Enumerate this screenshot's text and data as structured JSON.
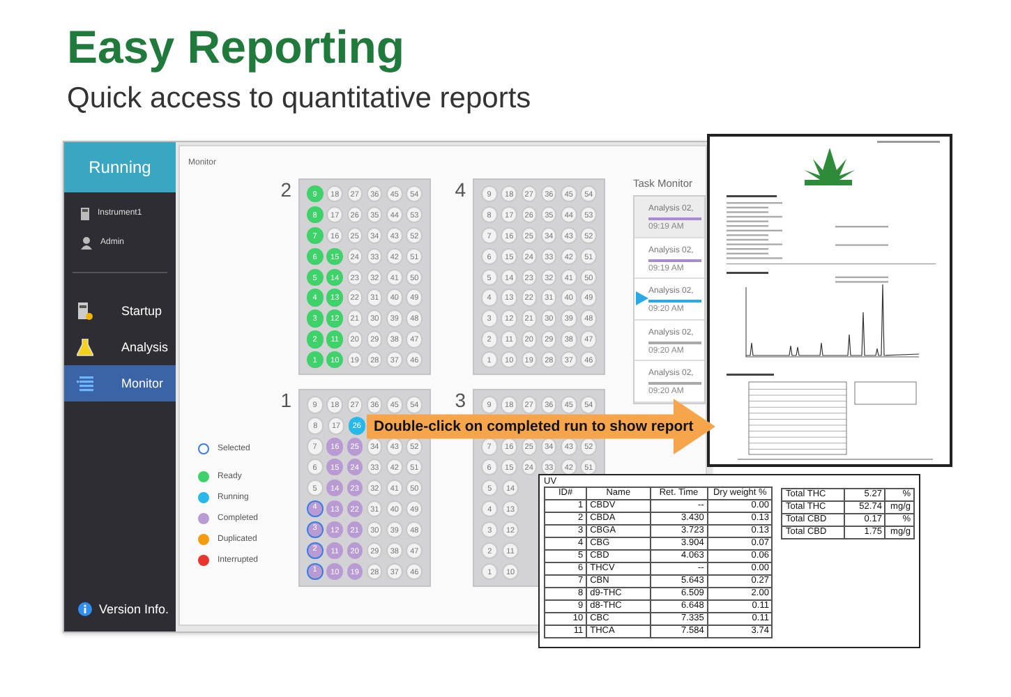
{
  "header": {
    "title": "Easy Reporting",
    "subtitle": "Quick access to quantitative reports"
  },
  "sidebar": {
    "status": "Running",
    "instrument": "Instrument1",
    "user": "Admin",
    "nav": [
      {
        "label": "Startup",
        "selected": false
      },
      {
        "label": "Analysis",
        "selected": false
      },
      {
        "label": "Monitor",
        "selected": true
      }
    ],
    "version": "Version Info."
  },
  "page_title": "Monitor",
  "legend": [
    {
      "label": "Selected",
      "kind": "ring",
      "color": "#3b7de0"
    },
    {
      "label": "Ready",
      "kind": "dot",
      "color": "#3fd16a"
    },
    {
      "label": "Running",
      "kind": "dot",
      "color": "#29b9e8"
    },
    {
      "label": "Completed",
      "kind": "dot",
      "color": "#b99bd3"
    },
    {
      "label": "Duplicated",
      "kind": "dot",
      "color": "#f39c12"
    },
    {
      "label": "Interrupted",
      "kind": "dot",
      "color": "#e8352e"
    }
  ],
  "plates": [
    {
      "label": "2",
      "rows": [
        [
          {
            "number": "9",
            "kind": "ready",
            "selected": false
          },
          {
            "number": "18",
            "kind": "empty",
            "selected": false
          },
          {
            "number": "27",
            "kind": "empty",
            "selected": false
          },
          {
            "number": "36",
            "kind": "empty",
            "selected": false
          },
          {
            "number": "45",
            "kind": "empty",
            "selected": false
          },
          {
            "number": "54",
            "kind": "empty",
            "selected": false
          }
        ],
        [
          {
            "number": "8",
            "kind": "ready",
            "selected": false
          },
          {
            "number": "17",
            "kind": "empty",
            "selected": false
          },
          {
            "number": "26",
            "kind": "empty",
            "selected": false
          },
          {
            "number": "35",
            "kind": "empty",
            "selected": false
          },
          {
            "number": "44",
            "kind": "empty",
            "selected": false
          },
          {
            "number": "53",
            "kind": "empty",
            "selected": false
          }
        ],
        [
          {
            "number": "7",
            "kind": "ready",
            "selected": false
          },
          {
            "number": "16",
            "kind": "empty",
            "selected": false
          },
          {
            "number": "25",
            "kind": "empty",
            "selected": false
          },
          {
            "number": "34",
            "kind": "empty",
            "selected": false
          },
          {
            "number": "43",
            "kind": "empty",
            "selected": false
          },
          {
            "number": "52",
            "kind": "empty",
            "selected": false
          }
        ],
        [
          {
            "number": "6",
            "kind": "ready",
            "selected": false
          },
          {
            "number": "15",
            "kind": "ready",
            "selected": false
          },
          {
            "number": "24",
            "kind": "empty",
            "selected": false
          },
          {
            "number": "33",
            "kind": "empty",
            "selected": false
          },
          {
            "number": "42",
            "kind": "empty",
            "selected": false
          },
          {
            "number": "51",
            "kind": "empty",
            "selected": false
          }
        ],
        [
          {
            "number": "5",
            "kind": "ready",
            "selected": false
          },
          {
            "number": "14",
            "kind": "ready",
            "selected": false
          },
          {
            "number": "23",
            "kind": "empty",
            "selected": false
          },
          {
            "number": "32",
            "kind": "empty",
            "selected": false
          },
          {
            "number": "41",
            "kind": "empty",
            "selected": false
          },
          {
            "number": "50",
            "kind": "empty",
            "selected": false
          }
        ],
        [
          {
            "number": "4",
            "kind": "ready",
            "selected": false
          },
          {
            "number": "13",
            "kind": "ready",
            "selected": false
          },
          {
            "number": "22",
            "kind": "empty",
            "selected": false
          },
          {
            "number": "31",
            "kind": "empty",
            "selected": false
          },
          {
            "number": "40",
            "kind": "empty",
            "selected": false
          },
          {
            "number": "49",
            "kind": "empty",
            "selected": false
          }
        ],
        [
          {
            "number": "3",
            "kind": "ready",
            "selected": false
          },
          {
            "number": "12",
            "kind": "ready",
            "selected": false
          },
          {
            "number": "21",
            "kind": "empty",
            "selected": false
          },
          {
            "number": "30",
            "kind": "empty",
            "selected": false
          },
          {
            "number": "39",
            "kind": "empty",
            "selected": false
          },
          {
            "number": "48",
            "kind": "empty",
            "selected": false
          }
        ],
        [
          {
            "number": "2",
            "kind": "ready",
            "selected": false
          },
          {
            "number": "11",
            "kind": "ready",
            "selected": false
          },
          {
            "number": "20",
            "kind": "empty",
            "selected": false
          },
          {
            "number": "29",
            "kind": "empty",
            "selected": false
          },
          {
            "number": "38",
            "kind": "empty",
            "selected": false
          },
          {
            "number": "47",
            "kind": "empty",
            "selected": false
          }
        ],
        [
          {
            "number": "1",
            "kind": "ready",
            "selected": false
          },
          {
            "number": "10",
            "kind": "ready",
            "selected": false
          },
          {
            "number": "19",
            "kind": "empty",
            "selected": false
          },
          {
            "number": "28",
            "kind": "empty",
            "selected": false
          },
          {
            "number": "37",
            "kind": "empty",
            "selected": false
          },
          {
            "number": "46",
            "kind": "empty",
            "selected": false
          }
        ]
      ]
    },
    {
      "label": "4",
      "rows": [
        [
          {
            "number": "9",
            "kind": "empty",
            "selected": false
          },
          {
            "number": "18",
            "kind": "empty",
            "selected": false
          },
          {
            "number": "27",
            "kind": "empty",
            "selected": false
          },
          {
            "number": "36",
            "kind": "empty",
            "selected": false
          },
          {
            "number": "45",
            "kind": "empty",
            "selected": false
          },
          {
            "number": "54",
            "kind": "empty",
            "selected": false
          }
        ],
        [
          {
            "number": "8",
            "kind": "empty",
            "selected": false
          },
          {
            "number": "17",
            "kind": "empty",
            "selected": false
          },
          {
            "number": "26",
            "kind": "empty",
            "selected": false
          },
          {
            "number": "35",
            "kind": "empty",
            "selected": false
          },
          {
            "number": "44",
            "kind": "empty",
            "selected": false
          },
          {
            "number": "53",
            "kind": "empty",
            "selected": false
          }
        ],
        [
          {
            "number": "7",
            "kind": "empty",
            "selected": false
          },
          {
            "number": "16",
            "kind": "empty",
            "selected": false
          },
          {
            "number": "25",
            "kind": "empty",
            "selected": false
          },
          {
            "number": "34",
            "kind": "empty",
            "selected": false
          },
          {
            "number": "43",
            "kind": "empty",
            "selected": false
          },
          {
            "number": "52",
            "kind": "empty",
            "selected": false
          }
        ],
        [
          {
            "number": "6",
            "kind": "empty",
            "selected": false
          },
          {
            "number": "15",
            "kind": "empty",
            "selected": false
          },
          {
            "number": "24",
            "kind": "empty",
            "selected": false
          },
          {
            "number": "33",
            "kind": "empty",
            "selected": false
          },
          {
            "number": "42",
            "kind": "empty",
            "selected": false
          },
          {
            "number": "51",
            "kind": "empty",
            "selected": false
          }
        ],
        [
          {
            "number": "5",
            "kind": "empty",
            "selected": false
          },
          {
            "number": "14",
            "kind": "empty",
            "selected": false
          },
          {
            "number": "23",
            "kind": "empty",
            "selected": false
          },
          {
            "number": "32",
            "kind": "empty",
            "selected": false
          },
          {
            "number": "41",
            "kind": "empty",
            "selected": false
          },
          {
            "number": "50",
            "kind": "empty",
            "selected": false
          }
        ],
        [
          {
            "number": "4",
            "kind": "empty",
            "selected": false
          },
          {
            "number": "13",
            "kind": "empty",
            "selected": false
          },
          {
            "number": "22",
            "kind": "empty",
            "selected": false
          },
          {
            "number": "31",
            "kind": "empty",
            "selected": false
          },
          {
            "number": "40",
            "kind": "empty",
            "selected": false
          },
          {
            "number": "49",
            "kind": "empty",
            "selected": false
          }
        ],
        [
          {
            "number": "3",
            "kind": "empty",
            "selected": false
          },
          {
            "number": "12",
            "kind": "empty",
            "selected": false
          },
          {
            "number": "21",
            "kind": "empty",
            "selected": false
          },
          {
            "number": "30",
            "kind": "empty",
            "selected": false
          },
          {
            "number": "39",
            "kind": "empty",
            "selected": false
          },
          {
            "number": "48",
            "kind": "empty",
            "selected": false
          }
        ],
        [
          {
            "number": "2",
            "kind": "empty",
            "selected": false
          },
          {
            "number": "11",
            "kind": "empty",
            "selected": false
          },
          {
            "number": "20",
            "kind": "empty",
            "selected": false
          },
          {
            "number": "29",
            "kind": "empty",
            "selected": false
          },
          {
            "number": "38",
            "kind": "empty",
            "selected": false
          },
          {
            "number": "47",
            "kind": "empty",
            "selected": false
          }
        ],
        [
          {
            "number": "1",
            "kind": "empty",
            "selected": false
          },
          {
            "number": "10",
            "kind": "empty",
            "selected": false
          },
          {
            "number": "19",
            "kind": "empty",
            "selected": false
          },
          {
            "number": "28",
            "kind": "empty",
            "selected": false
          },
          {
            "number": "37",
            "kind": "empty",
            "selected": false
          },
          {
            "number": "46",
            "kind": "empty",
            "selected": false
          }
        ]
      ]
    },
    {
      "label": "1",
      "rows": [
        [
          {
            "number": "9",
            "kind": "empty",
            "selected": false
          },
          {
            "number": "18",
            "kind": "empty",
            "selected": false
          },
          {
            "number": "27",
            "kind": "empty",
            "selected": false
          },
          {
            "number": "36",
            "kind": "empty",
            "selected": false
          },
          {
            "number": "45",
            "kind": "empty",
            "selected": false
          },
          {
            "number": "54",
            "kind": "empty",
            "selected": false
          }
        ],
        [
          {
            "number": "8",
            "kind": "empty",
            "selected": false
          },
          {
            "number": "17",
            "kind": "empty",
            "selected": false
          },
          {
            "number": "26",
            "kind": "running",
            "selected": false
          }
        ],
        [
          {
            "number": "7",
            "kind": "empty",
            "selected": false
          },
          {
            "number": "16",
            "kind": "completed",
            "selected": false
          },
          {
            "number": "25",
            "kind": "completed",
            "selected": false
          },
          {
            "number": "34",
            "kind": "empty",
            "selected": false
          },
          {
            "number": "43",
            "kind": "empty",
            "selected": false
          },
          {
            "number": "52",
            "kind": "empty",
            "selected": false
          }
        ],
        [
          {
            "number": "6",
            "kind": "empty",
            "selected": false
          },
          {
            "number": "15",
            "kind": "completed",
            "selected": false
          },
          {
            "number": "24",
            "kind": "completed",
            "selected": false
          },
          {
            "number": "33",
            "kind": "empty",
            "selected": false
          },
          {
            "number": "42",
            "kind": "empty",
            "selected": false
          },
          {
            "number": "51",
            "kind": "empty",
            "selected": false
          }
        ],
        [
          {
            "number": "5",
            "kind": "empty",
            "selected": false
          },
          {
            "number": "14",
            "kind": "completed",
            "selected": false
          },
          {
            "number": "23",
            "kind": "completed",
            "selected": false
          },
          {
            "number": "32",
            "kind": "empty",
            "selected": false
          },
          {
            "number": "41",
            "kind": "empty",
            "selected": false
          },
          {
            "number": "50",
            "kind": "empty",
            "selected": false
          }
        ],
        [
          {
            "number": "4",
            "kind": "completed",
            "selected": true
          },
          {
            "number": "13",
            "kind": "completed",
            "selected": false
          },
          {
            "number": "22",
            "kind": "completed",
            "selected": false
          },
          {
            "number": "31",
            "kind": "empty",
            "selected": false
          },
          {
            "number": "40",
            "kind": "empty",
            "selected": false
          },
          {
            "number": "49",
            "kind": "empty",
            "selected": false
          }
        ],
        [
          {
            "number": "3",
            "kind": "completed",
            "selected": true
          },
          {
            "number": "12",
            "kind": "completed",
            "selected": false
          },
          {
            "number": "21",
            "kind": "completed",
            "selected": false
          },
          {
            "number": "30",
            "kind": "empty",
            "selected": false
          },
          {
            "number": "39",
            "kind": "empty",
            "selected": false
          },
          {
            "number": "48",
            "kind": "empty",
            "selected": false
          }
        ],
        [
          {
            "number": "2",
            "kind": "completed",
            "selected": true
          },
          {
            "number": "11",
            "kind": "completed",
            "selected": false
          },
          {
            "number": "20",
            "kind": "completed",
            "selected": false
          },
          {
            "number": "29",
            "kind": "empty",
            "selected": false
          },
          {
            "number": "38",
            "kind": "empty",
            "selected": false
          },
          {
            "number": "47",
            "kind": "empty",
            "selected": false
          }
        ],
        [
          {
            "number": "1",
            "kind": "completed",
            "selected": true
          },
          {
            "number": "10",
            "kind": "completed",
            "selected": false
          },
          {
            "number": "19",
            "kind": "completed",
            "selected": false
          },
          {
            "number": "28",
            "kind": "empty",
            "selected": false
          },
          {
            "number": "37",
            "kind": "empty",
            "selected": false
          },
          {
            "number": "46",
            "kind": "empty",
            "selected": false
          }
        ]
      ]
    },
    {
      "label": "3",
      "rows": [
        [
          {
            "number": "9",
            "kind": "empty",
            "selected": false
          },
          {
            "number": "18",
            "kind": "empty",
            "selected": false
          },
          {
            "number": "27",
            "kind": "empty",
            "selected": false
          },
          {
            "number": "36",
            "kind": "empty",
            "selected": false
          },
          {
            "number": "45",
            "kind": "empty",
            "selected": false
          },
          {
            "number": "54",
            "kind": "empty",
            "selected": false
          }
        ],
        [],
        [
          {
            "number": "7",
            "kind": "empty",
            "selected": false
          },
          {
            "number": "16",
            "kind": "empty",
            "selected": false
          },
          {
            "number": "25",
            "kind": "empty",
            "selected": false
          },
          {
            "number": "34",
            "kind": "empty",
            "selected": false
          },
          {
            "number": "43",
            "kind": "empty",
            "selected": false
          },
          {
            "number": "52",
            "kind": "empty",
            "selected": false
          }
        ],
        [
          {
            "number": "6",
            "kind": "empty",
            "selected": false
          },
          {
            "number": "15",
            "kind": "empty",
            "selected": false
          },
          {
            "number": "24",
            "kind": "empty",
            "selected": false
          },
          {
            "number": "33",
            "kind": "empty",
            "selected": false
          },
          {
            "number": "42",
            "kind": "empty",
            "selected": false
          },
          {
            "number": "51",
            "kind": "empty",
            "selected": false
          }
        ],
        [
          {
            "number": "5",
            "kind": "empty",
            "selected": false
          },
          {
            "number": "14",
            "kind": "empty",
            "selected": false
          }
        ],
        [
          {
            "number": "4",
            "kind": "empty",
            "selected": false
          },
          {
            "number": "13",
            "kind": "empty",
            "selected": false
          }
        ],
        [
          {
            "number": "3",
            "kind": "empty",
            "selected": false
          },
          {
            "number": "12",
            "kind": "empty",
            "selected": false
          }
        ],
        [
          {
            "number": "2",
            "kind": "empty",
            "selected": false
          },
          {
            "number": "11",
            "kind": "empty",
            "selected": false
          }
        ],
        [
          {
            "number": "1",
            "kind": "empty",
            "selected": false
          },
          {
            "number": "10",
            "kind": "empty",
            "selected": false
          }
        ]
      ]
    }
  ],
  "task_monitor": {
    "title": "Task Monitor",
    "items": [
      {
        "title": "Analysis 02,",
        "time": "09:19 AM",
        "kind": "completed",
        "selected": true
      },
      {
        "title": "Analysis 02,",
        "time": "09:19 AM",
        "kind": "completed",
        "selected": false
      },
      {
        "title": "Analysis 02,",
        "time": "09:20 AM",
        "kind": "running",
        "selected": false
      },
      {
        "title": "Analysis 02,",
        "time": "09:20 AM",
        "kind": "waiting",
        "selected": false
      },
      {
        "title": "Analysis 02,",
        "time": "09:20 AM",
        "kind": "waiting",
        "selected": false
      }
    ]
  },
  "callout": "Double-click on completed run to show report",
  "report": {
    "section": "UV",
    "columns": [
      "ID#",
      "Name",
      "Ret. Time",
      "Dry weight %"
    ],
    "rows": [
      [
        "1",
        "CBDV",
        "--",
        "0.00"
      ],
      [
        "2",
        "CBDA",
        "3.430",
        "0.13"
      ],
      [
        "3",
        "CBGA",
        "3.723",
        "0.13"
      ],
      [
        "4",
        "CBG",
        "3.904",
        "0.07"
      ],
      [
        "5",
        "CBD",
        "4.063",
        "0.06"
      ],
      [
        "6",
        "THCV",
        "--",
        "0.00"
      ],
      [
        "7",
        "CBN",
        "5.643",
        "0.27"
      ],
      [
        "8",
        "d9-THC",
        "6.509",
        "2.00"
      ],
      [
        "9",
        "d8-THC",
        "6.648",
        "0.11"
      ],
      [
        "10",
        "CBC",
        "7.335",
        "0.11"
      ],
      [
        "11",
        "THCA",
        "7.584",
        "3.74"
      ]
    ],
    "totals": [
      [
        "Total THC",
        "5.27",
        "%"
      ],
      [
        "Total THC",
        "52.74",
        "mg/g"
      ],
      [
        "Total CBD",
        "0.17",
        "%"
      ],
      [
        "Total CBD",
        "1.75",
        "mg/g"
      ]
    ]
  }
}
